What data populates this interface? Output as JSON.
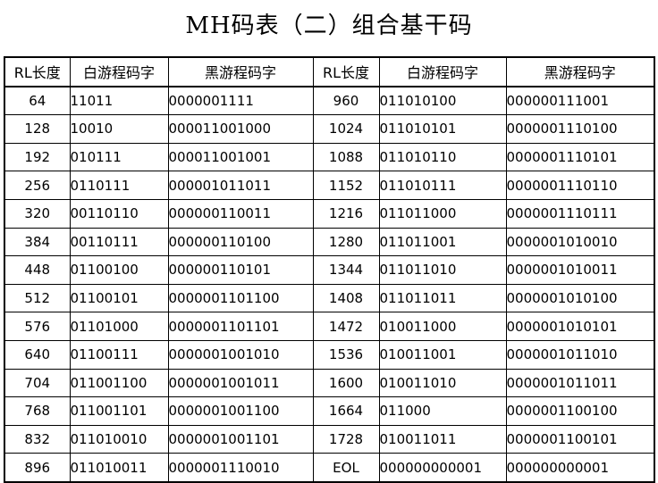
{
  "title": "MH码表（二）组合基干码",
  "headers": [
    "RL长度",
    "白游程码字",
    "黑游程码字",
    "RL长度",
    "白游程码字",
    "黑游程码字"
  ],
  "rows": [
    [
      "64",
      "11011",
      "0000001111",
      "960",
      "011010100",
      "000000111001"
    ],
    [
      "128",
      "10010",
      "000011001000",
      "1024",
      "011010101",
      "0000001110100"
    ],
    [
      "192",
      "010111",
      "000011001001",
      "1088",
      "011010110",
      "0000001110101"
    ],
    [
      "256",
      "0110111",
      "000001011011",
      "1152",
      "011010111",
      "0000001110110"
    ],
    [
      "320",
      "00110110",
      "000000110011",
      "1216",
      "011011000",
      "0000001110111"
    ],
    [
      "384",
      "00110111",
      "000000110100",
      "1280",
      "011011001",
      "0000001010010"
    ],
    [
      "448",
      "01100100",
      "000000110101",
      "1344",
      "011011010",
      "0000001010011"
    ],
    [
      "512",
      "01100101",
      "0000001101100",
      "1408",
      "011011011",
      "0000001010100"
    ],
    [
      "576",
      "01101000",
      "0000001101101",
      "1472",
      "010011000",
      "0000001010101"
    ],
    [
      "640",
      "01100111",
      "0000001001010",
      "1536",
      "010011001",
      "0000001011010"
    ],
    [
      "704",
      "011001100",
      "0000001001011",
      "1600",
      "010011010",
      "0000001011011"
    ],
    [
      "768",
      "011001101",
      "0000001001100",
      "1664",
      "011000",
      "0000001100100"
    ],
    [
      "832",
      "011010010",
      "0000001001101",
      "1728",
      "010011011",
      "0000001100101"
    ],
    [
      "896",
      "011010011",
      "0000001110010",
      "EOL",
      "000000000001",
      "000000000001"
    ]
  ]
}
